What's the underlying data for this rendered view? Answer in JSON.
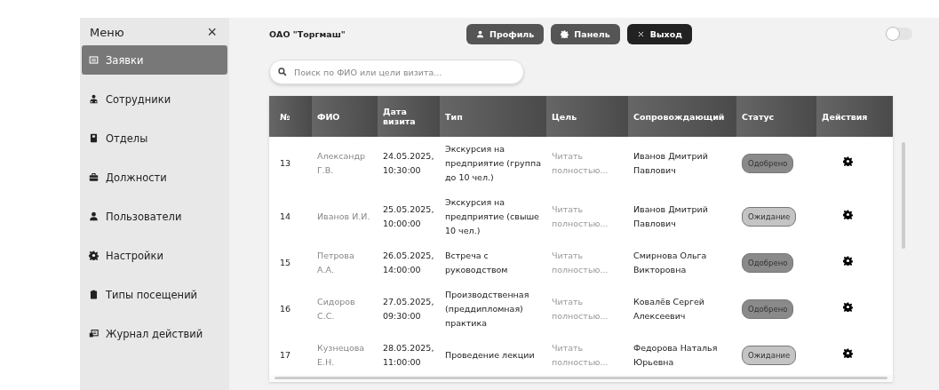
{
  "sidebar": {
    "title": "Меню",
    "close": "×",
    "items": [
      {
        "label": "Заявки",
        "selected": true
      },
      {
        "label": "Сотрудники",
        "selected": false
      },
      {
        "label": "Отделы",
        "selected": false
      },
      {
        "label": "Должности",
        "selected": false
      },
      {
        "label": "Пользователи",
        "selected": false
      },
      {
        "label": "Настройки",
        "selected": false
      },
      {
        "label": "Типы посещений",
        "selected": false
      },
      {
        "label": "Журнал действий",
        "selected": false
      }
    ]
  },
  "header": {
    "org": "ОАО \"Торгмаш\"",
    "buttons": [
      {
        "label": "Профиль",
        "kind": "normal"
      },
      {
        "label": "Панель",
        "kind": "normal"
      },
      {
        "label": "Выход",
        "kind": "dark"
      }
    ],
    "theme_toggle": {
      "on": false
    }
  },
  "search": {
    "placeholder": "Поиск по ФИО или цели визита..."
  },
  "table": {
    "columns": [
      "№",
      "ФИО",
      "Дата визита",
      "Тип",
      "Цель",
      "Сопровождающий",
      "Статус",
      "Действия"
    ],
    "rows": [
      {
        "number": "13",
        "name": "Александр Г.В.",
        "date": "24.05.2025, 10:30:00",
        "type": "Экскурсия на предприятие (группа до 10 чел.)",
        "goal": "Читать полностью...",
        "escort": "Иванов Дмитрий Павлович",
        "status": {
          "label": "Одобрено",
          "kind": "approved"
        }
      },
      {
        "number": "14",
        "name": "Иванов И.И.",
        "date": "25.05.2025, 10:00:00",
        "type": "Экскурсия на предприятие (свыше 10 чел.)",
        "goal": "Читать полностью...",
        "escort": "Иванов Дмитрий Павлович",
        "status": {
          "label": "Ожидание",
          "kind": "pending"
        }
      },
      {
        "number": "15",
        "name": "Петрова А.А.",
        "date": "26.05.2025, 14:00:00",
        "type": "Встреча с руководством",
        "goal": "Читать полностью...",
        "escort": "Смирнова Ольга Викторовна",
        "status": {
          "label": "Одобрено",
          "kind": "approved"
        }
      },
      {
        "number": "16",
        "name": "Сидоров С.С.",
        "date": "27.05.2025, 09:30:00",
        "type": "Производственная (преддипломная) практика",
        "goal": "Читать полностью...",
        "escort": "Ковалёв Сергей Алексеевич",
        "status": {
          "label": "Одобрено",
          "kind": "approved"
        }
      },
      {
        "number": "17",
        "name": "Кузнецова Е.Н.",
        "date": "28.05.2025, 11:00:00",
        "type": "Проведение лекции",
        "goal": "Читать полностью...",
        "escort": "Федорова Наталья Юрьевна",
        "status": {
          "label": "Ожидание",
          "kind": "pending"
        }
      }
    ]
  }
}
